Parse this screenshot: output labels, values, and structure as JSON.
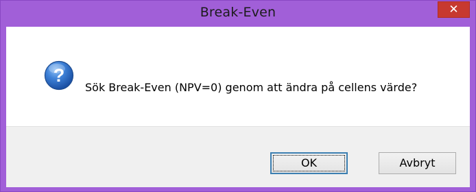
{
  "window": {
    "title": "Break-Even",
    "close_glyph": "✕",
    "title_bar_color": "#a15fd8",
    "close_button_color": "#c7392f"
  },
  "dialog": {
    "icon": "question-icon",
    "icon_glyph": "?",
    "message": "Sök Break-Even (NPV=0) genom att ändra på cellens värde?"
  },
  "buttons": {
    "ok_label": "OK",
    "cancel_label": "Avbryt"
  }
}
